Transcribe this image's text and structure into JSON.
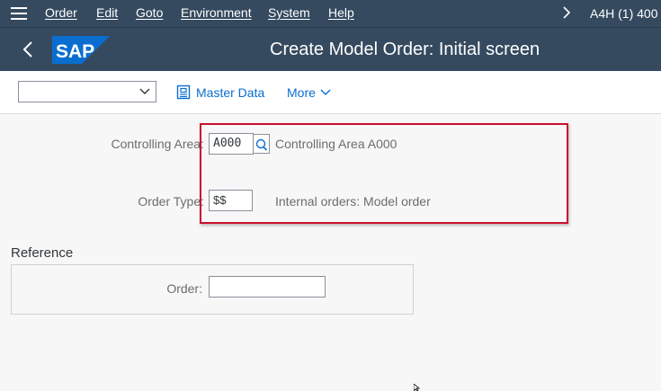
{
  "menubar": {
    "items": [
      {
        "label": "Order"
      },
      {
        "label": "Edit"
      },
      {
        "label": "Goto"
      },
      {
        "label": "Environment"
      },
      {
        "label": "System"
      },
      {
        "label": "Help"
      }
    ],
    "system_id": "A4H (1) 400",
    "icons": {
      "menu": "hamburger-icon",
      "expand": "chevron-right-icon"
    }
  },
  "header": {
    "title": "Create Model Order: Initial screen",
    "logo_text": "SAP",
    "icons": {
      "back": "chevron-left-icon"
    }
  },
  "toolbar": {
    "select_value": "",
    "master_data_label": "Master Data",
    "more_label": "More"
  },
  "form": {
    "controlling_area": {
      "label": "Controlling Area:",
      "value": "A000",
      "description": "Controlling Area A000"
    },
    "order_type": {
      "label": "Order Type:",
      "value": "$$",
      "description": "Internal orders: Model order"
    }
  },
  "reference": {
    "title": "Reference",
    "order_label": "Order:",
    "order_value": ""
  },
  "colors": {
    "shell": "#354a5f",
    "link": "#0a6ed1",
    "highlight": "#c8102e",
    "logo": "#0a6ed1"
  }
}
